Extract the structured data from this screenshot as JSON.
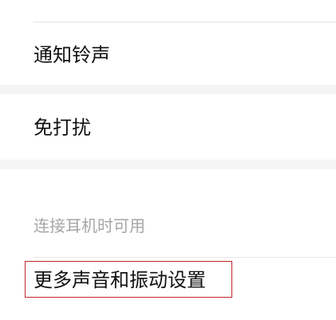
{
  "settings": {
    "items": [
      {
        "label": "通知铃声"
      },
      {
        "label": "免打扰"
      },
      {
        "label": "连接耳机时可用"
      },
      {
        "label": "更多声音和振动设置"
      }
    ]
  },
  "colors": {
    "text_primary": "#111111",
    "text_disabled": "#a6a6a6",
    "section_gap": "#f5f5f5",
    "divider": "#e6e6e6",
    "highlight_border": "#c0282d"
  }
}
